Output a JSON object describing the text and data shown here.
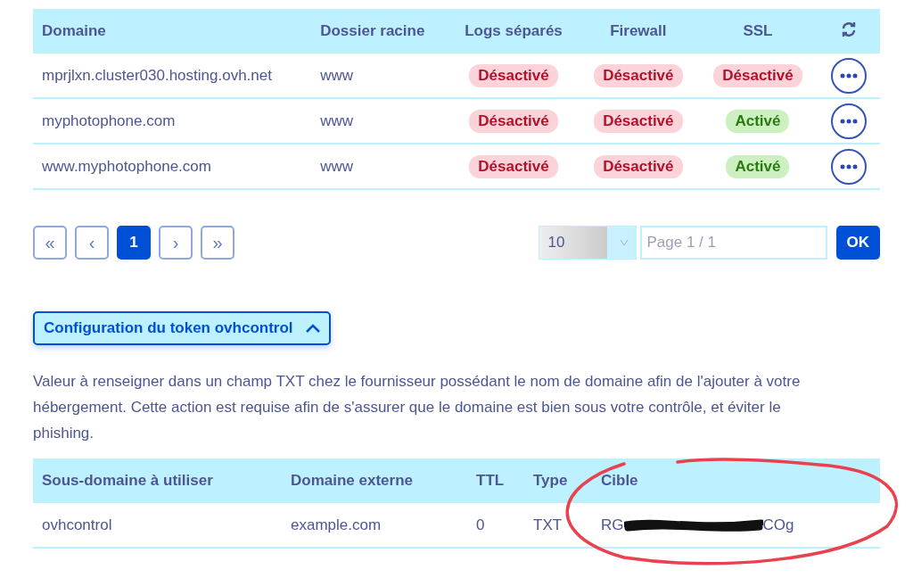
{
  "domains_table": {
    "columns": [
      "Domaine",
      "Dossier racine",
      "Logs séparés",
      "Firewall",
      "SSL"
    ],
    "rows": [
      {
        "domain": "mprjlxn.cluster030.hosting.ovh.net",
        "root": "www",
        "logs": {
          "label": "Désactivé",
          "active": false
        },
        "firewall": {
          "label": "Désactivé",
          "active": false
        },
        "ssl": {
          "label": "Désactivé",
          "active": false
        }
      },
      {
        "domain": "myphotophone.com",
        "root": "www",
        "logs": {
          "label": "Désactivé",
          "active": false
        },
        "firewall": {
          "label": "Désactivé",
          "active": false
        },
        "ssl": {
          "label": "Activé",
          "active": true
        }
      },
      {
        "domain": "www.myphotophone.com",
        "root": "www",
        "logs": {
          "label": "Désactivé",
          "active": false
        },
        "firewall": {
          "label": "Désactivé",
          "active": false
        },
        "ssl": {
          "label": "Activé",
          "active": true
        }
      }
    ]
  },
  "pagination": {
    "buttons": [
      {
        "label": "«",
        "selected": false
      },
      {
        "label": "‹",
        "selected": false
      },
      {
        "label": "1",
        "selected": true
      },
      {
        "label": "›",
        "selected": false
      },
      {
        "label": "»",
        "selected": false
      }
    ],
    "page_size": "10",
    "page_field": {
      "placeholder": "Page 1 / 1"
    },
    "ok_button": "OK"
  },
  "token_section": {
    "toggle": {
      "label": "Configuration du token ovhcontrol",
      "expanded": true
    },
    "description": "Valeur à renseigner dans un champ TXT chez le fournisseur possédant le nom de domaine afin de l'ajouter à votre hébergement. Cette action est requise afin de s'assurer que le domaine est bien sous votre contrôle, et éviter le phishing.",
    "table": {
      "columns": [
        "Sous-domaine à utiliser",
        "Domaine externe",
        "TTL",
        "Type",
        "Cible"
      ],
      "rows": [
        {
          "subdomain": "ovhcontrol",
          "external": "example.com",
          "ttl": "0",
          "type": "TXT",
          "target_start": "RG",
          "target_end": "COg"
        }
      ]
    }
  }
}
